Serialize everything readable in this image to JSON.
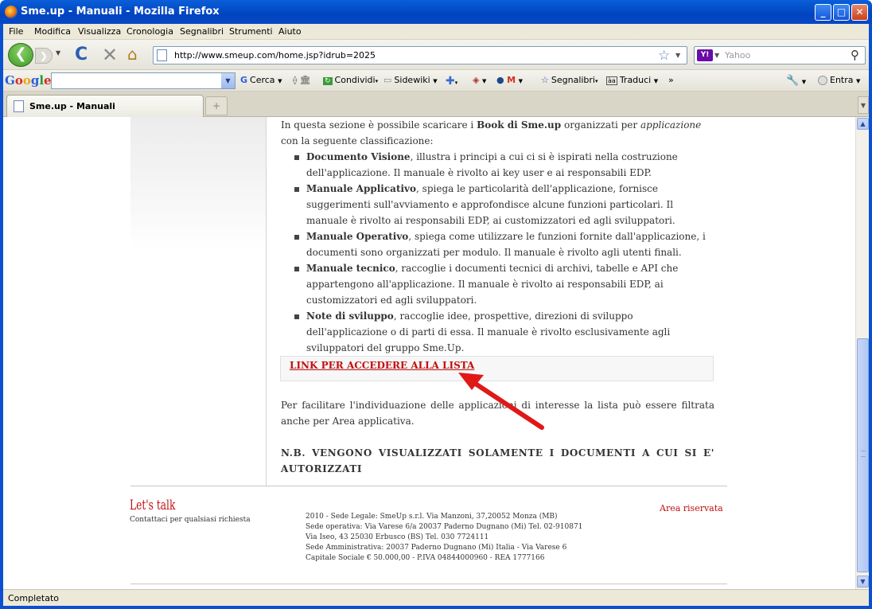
{
  "window": {
    "title": "Sme.up - Manuali - Mozilla Firefox"
  },
  "menu": [
    "File",
    "Modifica",
    "Visualizza",
    "Cronologia",
    "Segnalibri",
    "Strumenti",
    "Aiuto"
  ],
  "nav": {
    "url": "http://www.smeup.com/home.jsp?idrub=2025",
    "search_engine": "Y!",
    "search_placeholder": "Yahoo"
  },
  "google_toolbar": {
    "logo": "Google",
    "cerca": "Cerca",
    "condividi": "Condividi",
    "sidewiki": "Sidewiki",
    "segnalibri": "Segnalibri",
    "traduci": "Traduci",
    "more": "»",
    "entra": "Entra"
  },
  "tab": {
    "label": "Sme.up - Manuali",
    "newtab": "+"
  },
  "page": {
    "intro_a": "In questa sezione è possibile scaricare i",
    "intro_b": "Book di Sme.up",
    "intro_c": "organizzati per",
    "intro_d": "applicazione",
    "intro_e": "con la seguente classificazione:",
    "items": [
      {
        "title": "Documento Visione",
        "text": ", illustra i principi a cui ci si è ispirati nella costruzione dell'applicazione. Il manuale è rivolto ai key user e ai responsabili EDP."
      },
      {
        "title": "Manuale Applicativo",
        "text": ", spiega le particolarità dell'applicazione, fornisce suggerimenti sull'avviamento e approfondisce alcune funzioni particolari. Il manuale è rivolto ai responsabili EDP, ai customizzatori ed agli sviluppatori."
      },
      {
        "title": "Manuale Operativo",
        "text": ", spiega come utilizzare le funzioni fornite dall'applicazione, i documenti sono organizzati per modulo. Il manuale è rivolto agli utenti finali."
      },
      {
        "title": "Manuale tecnico",
        "text": ", raccoglie i documenti tecnici di archivi, tabelle e API che appartengono all'applicazione. Il manuale è rivolto ai responsabili EDP, ai customizzatori ed agli sviluppatori."
      },
      {
        "title": "Note di sviluppo",
        "text": ", raccoglie idee, prospettive, direzioni di sviluppo dell'applicazione o di parti di essa. Il manuale è rivolto esclusivamente agli sviluppatori del gruppo Sme.Up."
      }
    ],
    "list_link": "LINK PER ACCEDERE ALLA LISTA",
    "filter_text": "Per facilitare l'individuazione delle applicazioni di interesse la lista può essere filtrata anche per Area applicativa.",
    "nb_text": "N.B. VENGONO VISUALIZZATI SOLAMENTE I DOCUMENTI A CUI SI E' AUTORIZZATI"
  },
  "footer": {
    "lets_talk": "Let's talk",
    "contact": "Contattaci per qualsiasi richiesta",
    "address_lines": [
      "2010 - Sede Legale: SmeUp s.r.l. Via Manzoni, 37,20052 Monza (MB)",
      "Sede operativa: Via Varese 6/a 20037 Paderno Dugnano (Mi) Tel. 02-910871",
      "Via Iseo, 43 25030 Erbusco (BS) Tel. 030 7724111",
      "Sede Amministrativa: 20037 Paderno Dugnano (Mi) Italia - Via Varese 6",
      "Capitale Sociale € 50.000,00 - P.IVA 04844000960 - REA 1777166"
    ],
    "reserved": "Area riservata"
  },
  "status": {
    "text": "Completato"
  },
  "colors": {
    "titlebar": "#0a58d4",
    "link_red": "#c11010",
    "arrow_red": "#e01818"
  }
}
